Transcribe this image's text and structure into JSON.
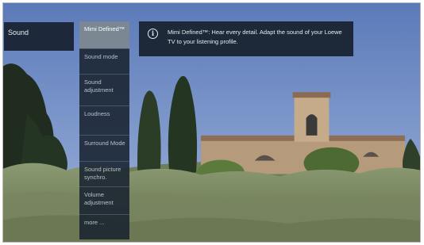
{
  "osd": {
    "section_title": "Sound"
  },
  "menu": {
    "items": [
      {
        "label": "Mimi Defined™",
        "selected": true
      },
      {
        "label": "Sound mode",
        "selected": false
      },
      {
        "label": "Sound adjustment",
        "selected": false
      },
      {
        "label": "Loudness",
        "selected": false
      },
      {
        "label": "Surround Mode",
        "selected": false
      },
      {
        "label": "Sound picture synchro.",
        "selected": false
      },
      {
        "label": "Volume adjustment",
        "selected": false
      },
      {
        "label": "more ...",
        "selected": false
      }
    ]
  },
  "info_panel": {
    "icon": "info-icon",
    "text": "Mimi Defined™: Hear every detail. Adapt the sound of your Loewe TV to your listening profile."
  },
  "colors": {
    "panel_background": "#182230",
    "selected_item": "#7b8793",
    "sky": "#6d8cc4"
  }
}
